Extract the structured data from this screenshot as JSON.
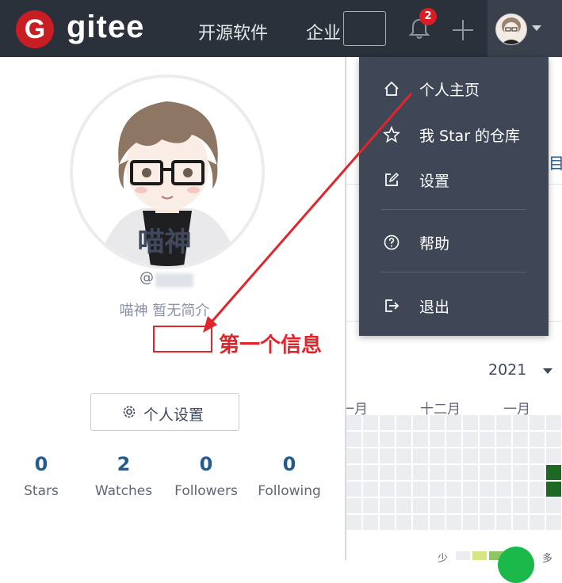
{
  "nav": {
    "logo_letter": "G",
    "logo_text": "gitee",
    "links": [
      "开源软件",
      "企业"
    ],
    "notification_count": "2"
  },
  "profile": {
    "name": "喵神",
    "handle_prefix": "@",
    "bio": "喵神 暂无简介",
    "settings_label": "个人设置",
    "stats": [
      {
        "value": "0",
        "label": "Stars"
      },
      {
        "value": "2",
        "label": "Watches"
      },
      {
        "value": "0",
        "label": "Followers"
      },
      {
        "value": "0",
        "label": "Following"
      }
    ]
  },
  "dropdown": {
    "items": [
      {
        "label": "个人主页",
        "icon": "home-icon"
      },
      {
        "label": "我 Star 的仓库",
        "icon": "star-icon"
      },
      {
        "label": "设置",
        "icon": "edit-icon"
      },
      {
        "label": "帮助",
        "icon": "help-icon"
      },
      {
        "label": "退出",
        "icon": "logout-icon"
      }
    ]
  },
  "contrib": {
    "year": "2021",
    "months": [
      "一月",
      "十二月",
      "一月"
    ],
    "legend_less": "少",
    "legend_more": "多",
    "edge_text": "目"
  },
  "annotation": {
    "label": "第一个信息"
  },
  "colors": {
    "nav_bg": "#2b313b",
    "logo_red": "#c71d23",
    "dropdown_bg": "#3f4756",
    "stat_blue": "#245b8f",
    "annotation_red": "#e0262b",
    "contrib_green": "#1e6823"
  }
}
